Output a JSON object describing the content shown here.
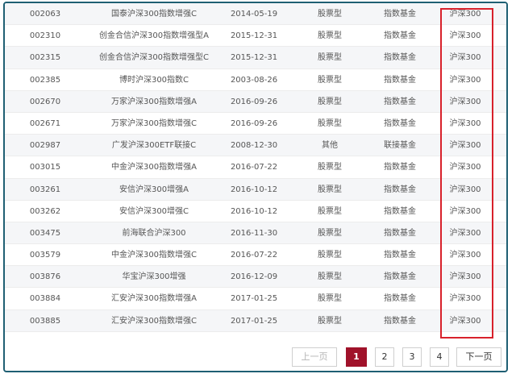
{
  "colors": {
    "frame": "#1f5f73",
    "highlight": "#d8212b",
    "active_page": "#a0122a"
  },
  "rows": [
    {
      "code": "002063",
      "name": "国泰沪深300指数增强C",
      "date": "2014-05-19",
      "type": "股票型",
      "category": "指数基金",
      "index": "沪深300"
    },
    {
      "code": "002310",
      "name": "创金合信沪深300指数增强型A",
      "date": "2015-12-31",
      "type": "股票型",
      "category": "指数基金",
      "index": "沪深300"
    },
    {
      "code": "002315",
      "name": "创金合信沪深300指数增强型C",
      "date": "2015-12-31",
      "type": "股票型",
      "category": "指数基金",
      "index": "沪深300"
    },
    {
      "code": "002385",
      "name": "博时沪深300指数C",
      "date": "2003-08-26",
      "type": "股票型",
      "category": "指数基金",
      "index": "沪深300"
    },
    {
      "code": "002670",
      "name": "万家沪深300指数增强A",
      "date": "2016-09-26",
      "type": "股票型",
      "category": "指数基金",
      "index": "沪深300"
    },
    {
      "code": "002671",
      "name": "万家沪深300指数增强C",
      "date": "2016-09-26",
      "type": "股票型",
      "category": "指数基金",
      "index": "沪深300"
    },
    {
      "code": "002987",
      "name": "广发沪深300ETF联接C",
      "date": "2008-12-30",
      "type": "其他",
      "category": "联接基金",
      "index": "沪深300"
    },
    {
      "code": "003015",
      "name": "中金沪深300指数增强A",
      "date": "2016-07-22",
      "type": "股票型",
      "category": "指数基金",
      "index": "沪深300"
    },
    {
      "code": "003261",
      "name": "安信沪深300增强A",
      "date": "2016-10-12",
      "type": "股票型",
      "category": "指数基金",
      "index": "沪深300"
    },
    {
      "code": "003262",
      "name": "安信沪深300增强C",
      "date": "2016-10-12",
      "type": "股票型",
      "category": "指数基金",
      "index": "沪深300"
    },
    {
      "code": "003475",
      "name": "前海联合沪深300",
      "date": "2016-11-30",
      "type": "股票型",
      "category": "指数基金",
      "index": "沪深300"
    },
    {
      "code": "003579",
      "name": "中金沪深300指数增强C",
      "date": "2016-07-22",
      "type": "股票型",
      "category": "指数基金",
      "index": "沪深300"
    },
    {
      "code": "003876",
      "name": "华宝沪深300增强",
      "date": "2016-12-09",
      "type": "股票型",
      "category": "指数基金",
      "index": "沪深300"
    },
    {
      "code": "003884",
      "name": "汇安沪深300指数增强A",
      "date": "2017-01-25",
      "type": "股票型",
      "category": "指数基金",
      "index": "沪深300"
    },
    {
      "code": "003885",
      "name": "汇安沪深300指数增强C",
      "date": "2017-01-25",
      "type": "股票型",
      "category": "指数基金",
      "index": "沪深300"
    }
  ],
  "pagination": {
    "prev_label": "上一页",
    "pages": [
      "1",
      "2",
      "3",
      "4"
    ],
    "current": "1",
    "next_label": "下一页"
  }
}
